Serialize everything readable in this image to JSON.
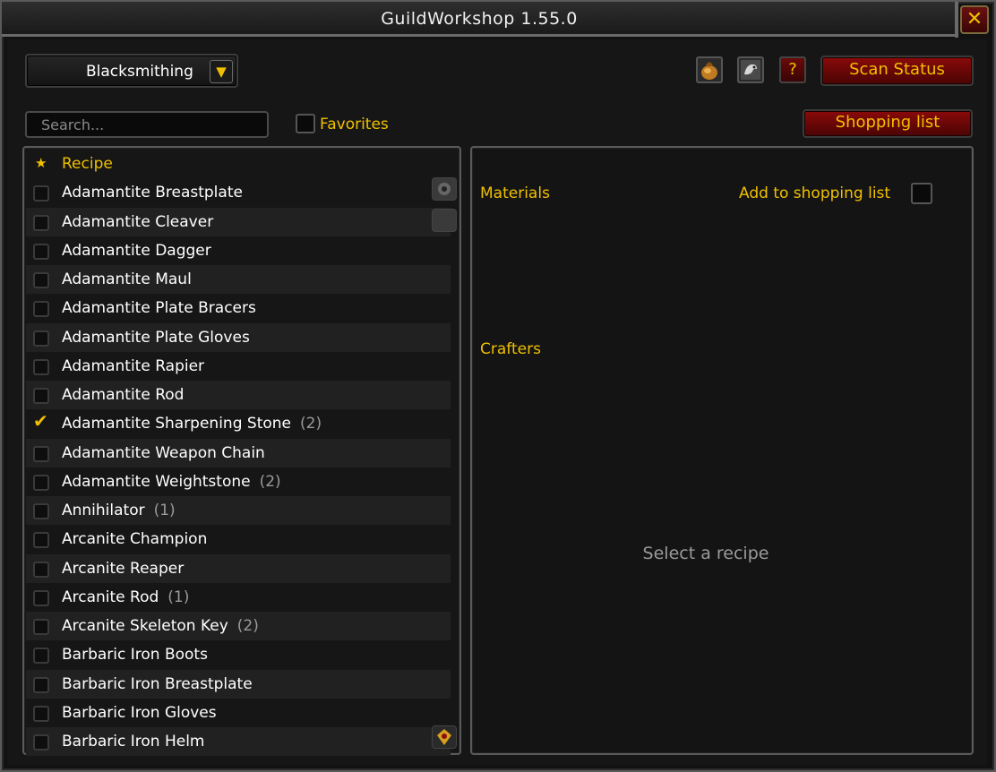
{
  "window": {
    "title": "GuildWorkshop 1.55.0",
    "close_label": "✕"
  },
  "profession_dropdown": {
    "selected": "Blacksmithing"
  },
  "toolbar": {
    "help_label": "?",
    "scan_status_label": "Scan Status",
    "shopping_list_label": "Shopping list"
  },
  "search": {
    "placeholder": "Search..."
  },
  "favorites": {
    "label": "Favorites"
  },
  "recipe_list": {
    "header": "Recipe",
    "items": [
      {
        "name": "Adamantite Breastplate",
        "checked": false,
        "count": ""
      },
      {
        "name": "Adamantite Cleaver",
        "checked": false,
        "count": ""
      },
      {
        "name": "Adamantite Dagger",
        "checked": false,
        "count": ""
      },
      {
        "name": "Adamantite Maul",
        "checked": false,
        "count": ""
      },
      {
        "name": "Adamantite Plate Bracers",
        "checked": false,
        "count": ""
      },
      {
        "name": "Adamantite Plate Gloves",
        "checked": false,
        "count": ""
      },
      {
        "name": "Adamantite Rapier",
        "checked": false,
        "count": ""
      },
      {
        "name": "Adamantite Rod",
        "checked": false,
        "count": ""
      },
      {
        "name": "Adamantite Sharpening Stone",
        "checked": true,
        "count": "(2)"
      },
      {
        "name": "Adamantite Weapon Chain",
        "checked": false,
        "count": ""
      },
      {
        "name": "Adamantite Weightstone",
        "checked": false,
        "count": "(2)"
      },
      {
        "name": "Annihilator",
        "checked": false,
        "count": "(1)"
      },
      {
        "name": "Arcanite Champion",
        "checked": false,
        "count": ""
      },
      {
        "name": "Arcanite Reaper",
        "checked": false,
        "count": ""
      },
      {
        "name": "Arcanite Rod",
        "checked": false,
        "count": "(1)"
      },
      {
        "name": "Arcanite Skeleton Key",
        "checked": false,
        "count": "(2)"
      },
      {
        "name": "Barbaric Iron Boots",
        "checked": false,
        "count": ""
      },
      {
        "name": "Barbaric Iron Breastplate",
        "checked": false,
        "count": ""
      },
      {
        "name": "Barbaric Iron Gloves",
        "checked": false,
        "count": ""
      },
      {
        "name": "Barbaric Iron Helm",
        "checked": false,
        "count": ""
      }
    ]
  },
  "detail": {
    "materials_label": "Materials",
    "add_to_shopping_label": "Add to shopping list",
    "crafters_label": "Crafters",
    "empty_text": "Select a recipe"
  },
  "colors": {
    "gold": "#f0c000",
    "button_red": "#8a0a0a"
  }
}
